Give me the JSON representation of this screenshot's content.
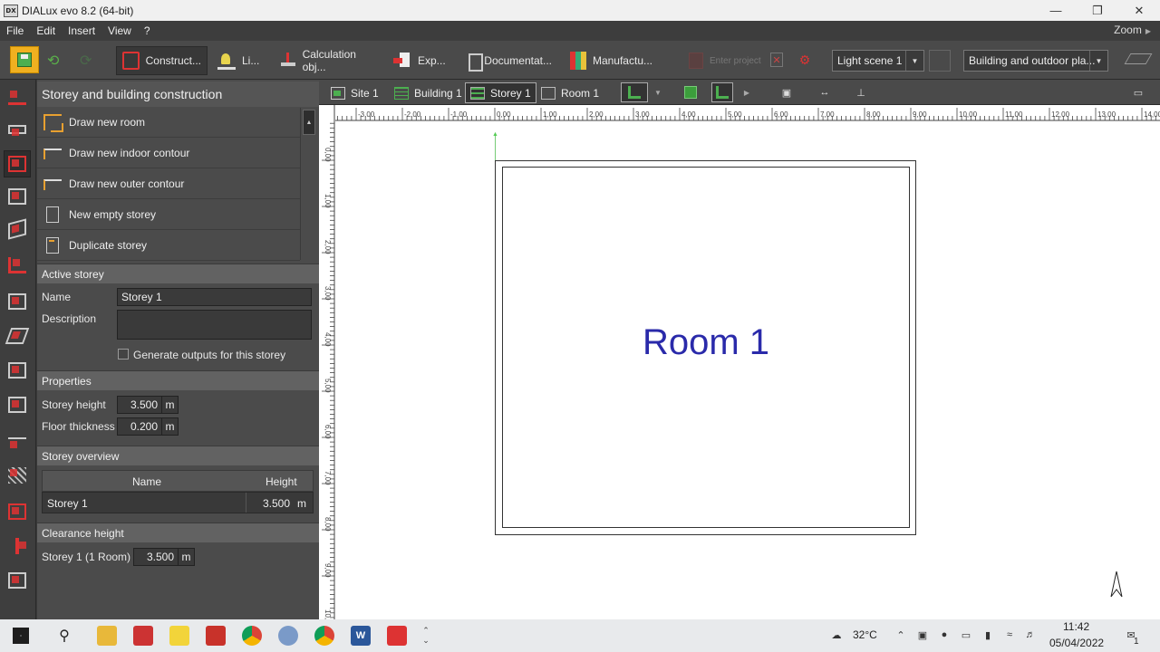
{
  "window": {
    "app_icon_text": "DX",
    "title": "DIALux evo 8.2  (64-bit)"
  },
  "menu": {
    "items": [
      "File",
      "Edit",
      "Insert",
      "View",
      "?"
    ],
    "zoom_label": "Zoom"
  },
  "toolbar": {
    "modes": [
      {
        "label": "Construct...",
        "icon": "construction-icon",
        "active": true
      },
      {
        "label": "Li...",
        "icon": "light-icon",
        "active": false
      },
      {
        "label": "Calculation obj...",
        "icon": "calculation-objects-icon",
        "active": false
      },
      {
        "label": "Exp...",
        "icon": "export-icon",
        "active": false
      },
      {
        "label": "Documentat...",
        "icon": "documentation-icon",
        "active": false
      },
      {
        "label": "Manufactu...",
        "icon": "manufacturers-icon",
        "active": false
      }
    ],
    "disabled_label": "Enter project",
    "light_scene": "Light scene 1",
    "view_mode": "Building and outdoor pla..."
  },
  "left_panel": {
    "title": "Storey and building construction",
    "actions": [
      {
        "label": "Draw new room",
        "icon": "draw-room-icon"
      },
      {
        "label": "Draw new indoor contour",
        "icon": "indoor-contour-icon"
      },
      {
        "label": "Draw new outer contour",
        "icon": "outer-contour-icon"
      },
      {
        "label": "New empty storey",
        "icon": "empty-storey-icon"
      },
      {
        "label": "Duplicate storey",
        "icon": "duplicate-storey-icon"
      }
    ],
    "active_storey": {
      "header": "Active storey",
      "name_label": "Name",
      "name_value": "Storey 1",
      "description_label": "Description",
      "description_value": "",
      "generate_outputs_label": "Generate outputs for this storey",
      "generate_outputs_checked": false
    },
    "properties": {
      "header": "Properties",
      "storey_height_label": "Storey height",
      "storey_height_value": "3.500",
      "floor_thickness_label": "Floor thickness",
      "floor_thickness_value": "0.200",
      "unit": "m"
    },
    "overview": {
      "header": "Storey overview",
      "col_name": "Name",
      "col_height": "Height",
      "rows": [
        {
          "name": "Storey 1",
          "height": "3.500",
          "unit": "m"
        }
      ]
    },
    "clearance": {
      "header": "Clearance height",
      "label": "Storey 1 (1 Room)",
      "value": "3.500",
      "unit": "m"
    }
  },
  "view_tabs": [
    {
      "label": "Site 1",
      "icon": "site-icon",
      "active": false
    },
    {
      "label": "Building 1",
      "icon": "building-icon",
      "active": false
    },
    {
      "label": "Storey 1",
      "icon": "storey-icon",
      "active": true
    },
    {
      "label": "Room 1",
      "icon": "room-icon",
      "active": false
    }
  ],
  "canvas": {
    "room_label": "Room 1",
    "h_ruler_labels": [
      "-3,00",
      "-2,00",
      "-1,00",
      "0,00",
      "1,00",
      "2,00",
      "3,00",
      "4,00",
      "5,00",
      "6,00",
      "7,00",
      "8,00",
      "9,00",
      "10,00",
      "11,00",
      "12,00",
      "13,00",
      "14,00"
    ],
    "v_ruler_labels": [
      "0,00",
      "1,00",
      "2,00",
      "3,00",
      "4,00",
      "5,00",
      "6,00",
      "7,00",
      "8,00",
      "9,00",
      "10,00"
    ]
  },
  "taskbar": {
    "temperature": "32°C",
    "time": "11:42",
    "date": "05/04/2022",
    "notifications": "1",
    "word_label": "W"
  },
  "colors": {
    "accent_red": "#dd3333",
    "accent_orange": "#e8a030",
    "room_label_blue": "#2a2aaa",
    "save_yellow": "#f0b020"
  }
}
